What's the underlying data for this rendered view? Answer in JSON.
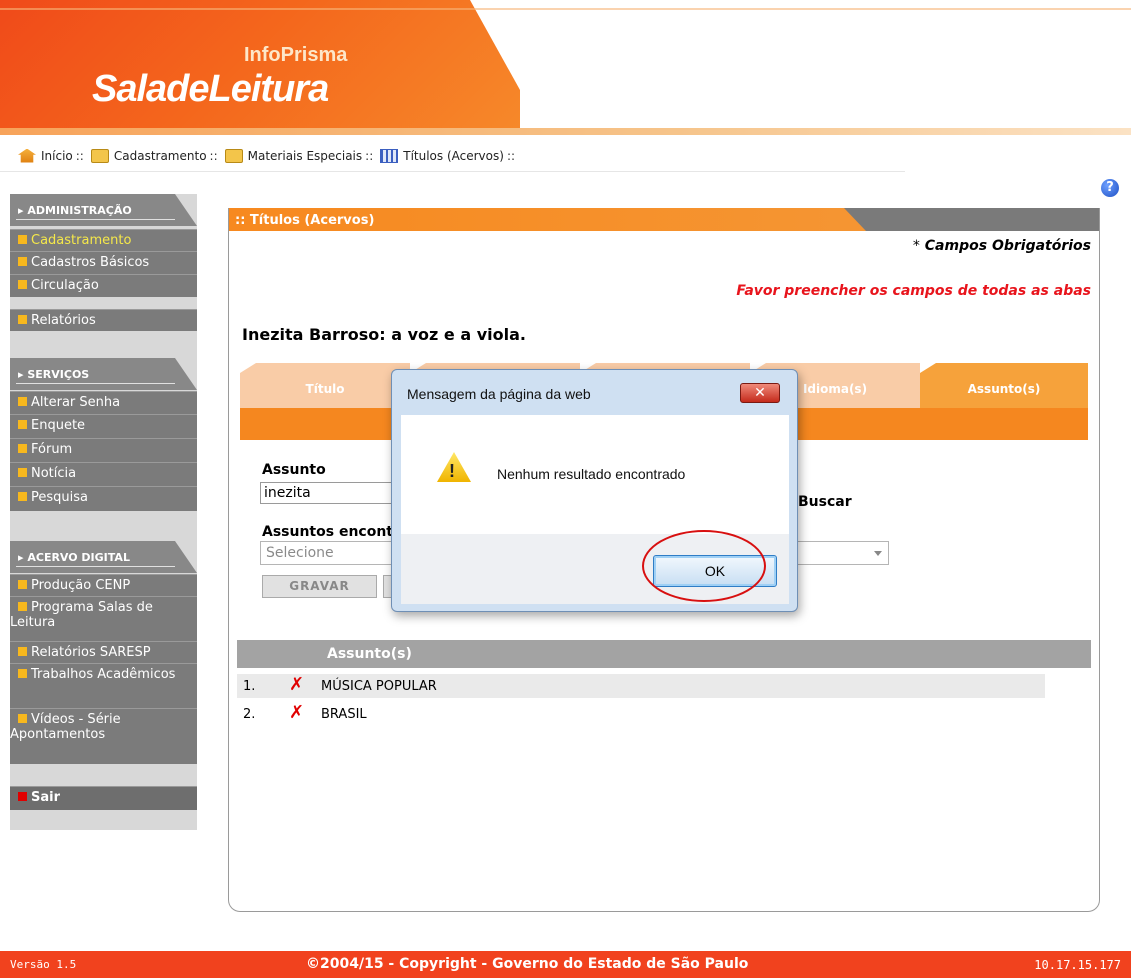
{
  "header": {
    "brand_small": "InfoPrisma",
    "brand_big": "SaladeLeitura"
  },
  "breadcrumb": {
    "items": [
      "Início",
      "Cadastramento",
      "Materiais Especiais",
      "Títulos (Acervos)"
    ],
    "separator": "::"
  },
  "sidebar": {
    "sections": [
      {
        "title": "ADMINISTRAÇÃO",
        "items": [
          "Cadastramento",
          "Cadastros Básicos",
          "Circulação",
          "Relatórios"
        ]
      },
      {
        "title": "SERVIÇOS",
        "items": [
          "Alterar Senha",
          "Enquete",
          "Fórum",
          "Notícia",
          "Pesquisa"
        ]
      },
      {
        "title": "ACERVO DIGITAL",
        "items": [
          "Produção CENP",
          "Programa Salas de Leitura",
          "Relatórios SARESP",
          "Trabalhos Acadêmicos",
          "Vídeos - Série Apontamentos"
        ]
      }
    ],
    "logout": "Sair",
    "active_item": "Cadastramento"
  },
  "panel": {
    "title": ":: Títulos (Acervos)",
    "required_note_star": "*",
    "required_note": "Campos Obrigatórios",
    "fill_all_note": "Favor preencher os campos de todas as abas",
    "book_title": "Inezita Barroso: a voz e a viola.",
    "tabs": [
      "Título",
      "",
      "",
      "Idioma(s)",
      "Assunto(s)"
    ],
    "active_tab": "Assunto(s)",
    "assunto_label": "Assunto",
    "assunto_value": "inezita",
    "buscar_label": "Buscar",
    "found_label": "Assuntos encontrados",
    "found_select": "Selecione",
    "save_button": "GRAVAR",
    "list_header": "Assunto(s)",
    "subjects": [
      {
        "num": "1.",
        "name": "MÚSICA POPULAR"
      },
      {
        "num": "2.",
        "name": "BRASIL"
      }
    ]
  },
  "dialog": {
    "title": "Mensagem da página da web",
    "close": "✕",
    "message": "Nenhum resultado encontrado",
    "ok": "OK"
  },
  "footer": {
    "version": "Versão 1.5",
    "copyright": "©2004/15 - Copyright - Governo do Estado de São Paulo",
    "ip": "10.17.15.177"
  },
  "colors": {
    "brand_orange": "#f04a1a",
    "panel_orange": "#f7891f",
    "active_tab": "#f6a23b",
    "sidebar_gray": "#7b7b7b",
    "alert_red": "#e8141c"
  },
  "icons": [
    "home-icon",
    "folder-icon",
    "grid-icon",
    "help-icon",
    "warning-icon",
    "delete-icon"
  ]
}
